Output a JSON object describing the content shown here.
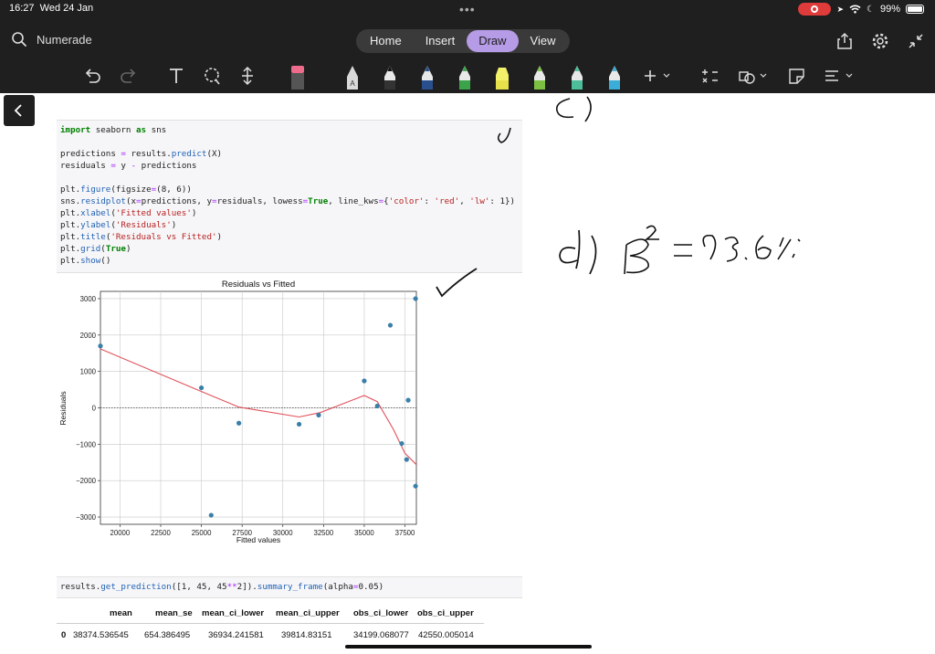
{
  "status_bar": {
    "time": "16:27",
    "date": "Wed 24 Jan",
    "battery": "99%",
    "battery_level": 0.99
  },
  "header": {
    "search_placeholder": "Numerade",
    "tabs": [
      {
        "label": "Home",
        "active": false
      },
      {
        "label": "Insert",
        "active": false
      },
      {
        "label": "Draw",
        "active": true
      },
      {
        "label": "View",
        "active": false
      }
    ],
    "right_icons": [
      "share-icon",
      "gear-icon",
      "collapse-icon"
    ]
  },
  "toolbar": {
    "tools": [
      "undo-icon",
      "redo-icon",
      "text-tool-icon",
      "lasso-icon",
      "space-insert-icon",
      "eraser-icon",
      "pencil-icon",
      "pen-black-icon",
      "pen-blue-icon",
      "pen-green-icon",
      "highlighter-yellow-icon",
      "pen-green-2-icon",
      "pen-teal-icon",
      "pen-cyan-icon",
      "add-tool-icon",
      "math-icon",
      "shapes-icon",
      "ink-to-shape-icon",
      "ink-to-text-icon"
    ],
    "accent": "#b69be6"
  },
  "code_cell": {
    "lines": [
      [
        "import",
        " seaborn ",
        "as",
        " sns"
      ],
      [
        "predictions ",
        "=",
        " results.",
        "predict",
        "(X)"
      ],
      [
        "residuals ",
        "=",
        " y ",
        "-",
        " predictions"
      ],
      [
        "plt.",
        "figure",
        "(figsize",
        "=",
        "(8, 6))"
      ],
      [
        "sns.",
        "residplot",
        "(x",
        "=",
        "predictions, y",
        "=",
        "residuals, lowess",
        "=",
        "True",
        ", line_kws",
        "=",
        "{",
        "'color'",
        ": ",
        "'red'",
        ", ",
        "'lw'",
        ": 1})"
      ],
      [
        "plt.",
        "xlabel",
        "(",
        "'Fitted values'",
        ")"
      ],
      [
        "plt.",
        "ylabel",
        "(",
        "'Residuals'",
        ")"
      ],
      [
        "plt.",
        "title",
        "(",
        "'Residuals vs Fitted'",
        ")"
      ],
      [
        "plt.",
        "grid",
        "(",
        "True",
        ")"
      ],
      [
        "plt.",
        "show",
        "()"
      ]
    ]
  },
  "chart_data": {
    "type": "scatter",
    "title": "Residuals vs Fitted",
    "xlabel": "Fitted values",
    "ylabel": "Residuals",
    "xlim": [
      18800,
      38200
    ],
    "ylim": [
      -3200,
      3200
    ],
    "xticks": [
      "20000",
      "22500",
      "25000",
      "27500",
      "30000",
      "32500",
      "35000",
      "37500"
    ],
    "xtick_values": [
      20000,
      22500,
      25000,
      27500,
      30000,
      32500,
      35000,
      37500
    ],
    "yticks": [
      "3000",
      "2000",
      "1000",
      "0",
      "−1000",
      "−2000",
      "−3000"
    ],
    "ytick_values": [
      3000,
      2000,
      1000,
      0,
      -1000,
      -2000,
      -3000
    ],
    "points": [
      [
        18800,
        1700
      ],
      [
        25000,
        550
      ],
      [
        25600,
        -2950
      ],
      [
        27300,
        -420
      ],
      [
        31000,
        -450
      ],
      [
        32200,
        -200
      ],
      [
        35000,
        740
      ],
      [
        35800,
        50
      ],
      [
        36600,
        2270
      ],
      [
        37300,
        -980
      ],
      [
        37600,
        -1420
      ],
      [
        37700,
        210
      ],
      [
        38150,
        3000
      ],
      [
        38150,
        -2150
      ]
    ],
    "lowess": [
      [
        18800,
        1620
      ],
      [
        25000,
        450
      ],
      [
        27300,
        20
      ],
      [
        31000,
        -250
      ],
      [
        32300,
        -130
      ],
      [
        35000,
        340
      ],
      [
        35800,
        170
      ],
      [
        36800,
        -600
      ],
      [
        37500,
        -1250
      ],
      [
        38200,
        -1560
      ]
    ],
    "point_color": "#3a7fa8",
    "line_color": "#e0505a",
    "grid": true,
    "zero_line": true
  },
  "prediction_cell": {
    "segments": [
      "results.",
      "get_prediction",
      "([1, 45, 45",
      "**",
      "2]).",
      "summary_frame",
      "(alpha",
      "=",
      "0.05)"
    ]
  },
  "summary_table": {
    "headers": [
      "mean",
      "mean_se",
      "mean_ci_lower",
      "mean_ci_upper",
      "obs_ci_lower",
      "obs_ci_upper"
    ],
    "row_index": "0",
    "row": [
      "38374.536545",
      "654.386495",
      "36934.241581",
      "39814.83151",
      "34199.068077",
      "42550.005014"
    ]
  },
  "handwriting": {
    "c_label": "C)",
    "d_label": "d)",
    "r2_text": "R² = 93.6%"
  }
}
